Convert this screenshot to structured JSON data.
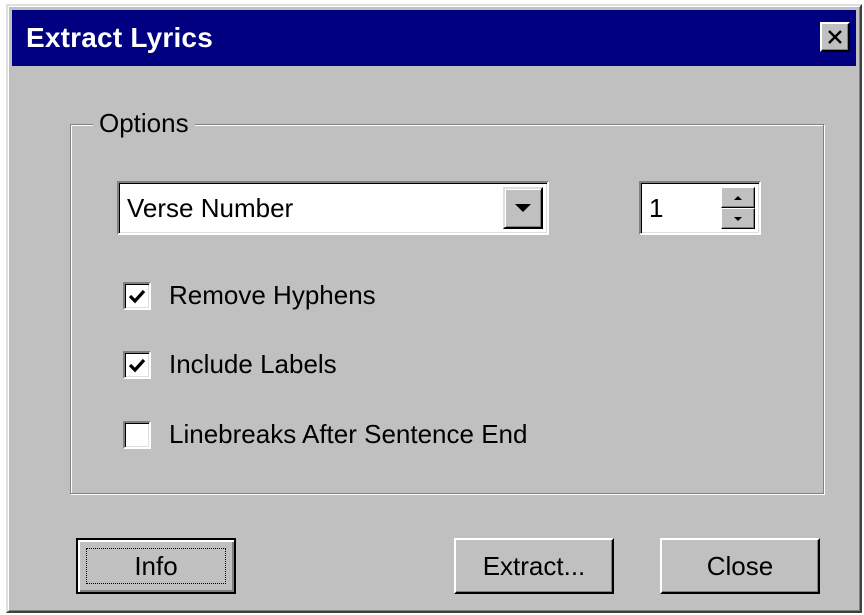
{
  "window": {
    "title": "Extract Lyrics",
    "close_icon": "close-icon"
  },
  "options": {
    "group_label": "Options",
    "combo": {
      "selected": "Verse Number",
      "arrow_icon": "chevron-down-icon"
    },
    "spin": {
      "value": "1"
    },
    "checkboxes": [
      {
        "label": "Remove Hyphens",
        "checked": true
      },
      {
        "label": "Include Labels",
        "checked": true
      },
      {
        "label": "Linebreaks After Sentence End",
        "checked": false
      }
    ]
  },
  "buttons": {
    "info": "Info",
    "extract": "Extract...",
    "close": "Close"
  },
  "colors": {
    "titlebar": "#000080",
    "face": "#c0c0c0"
  }
}
